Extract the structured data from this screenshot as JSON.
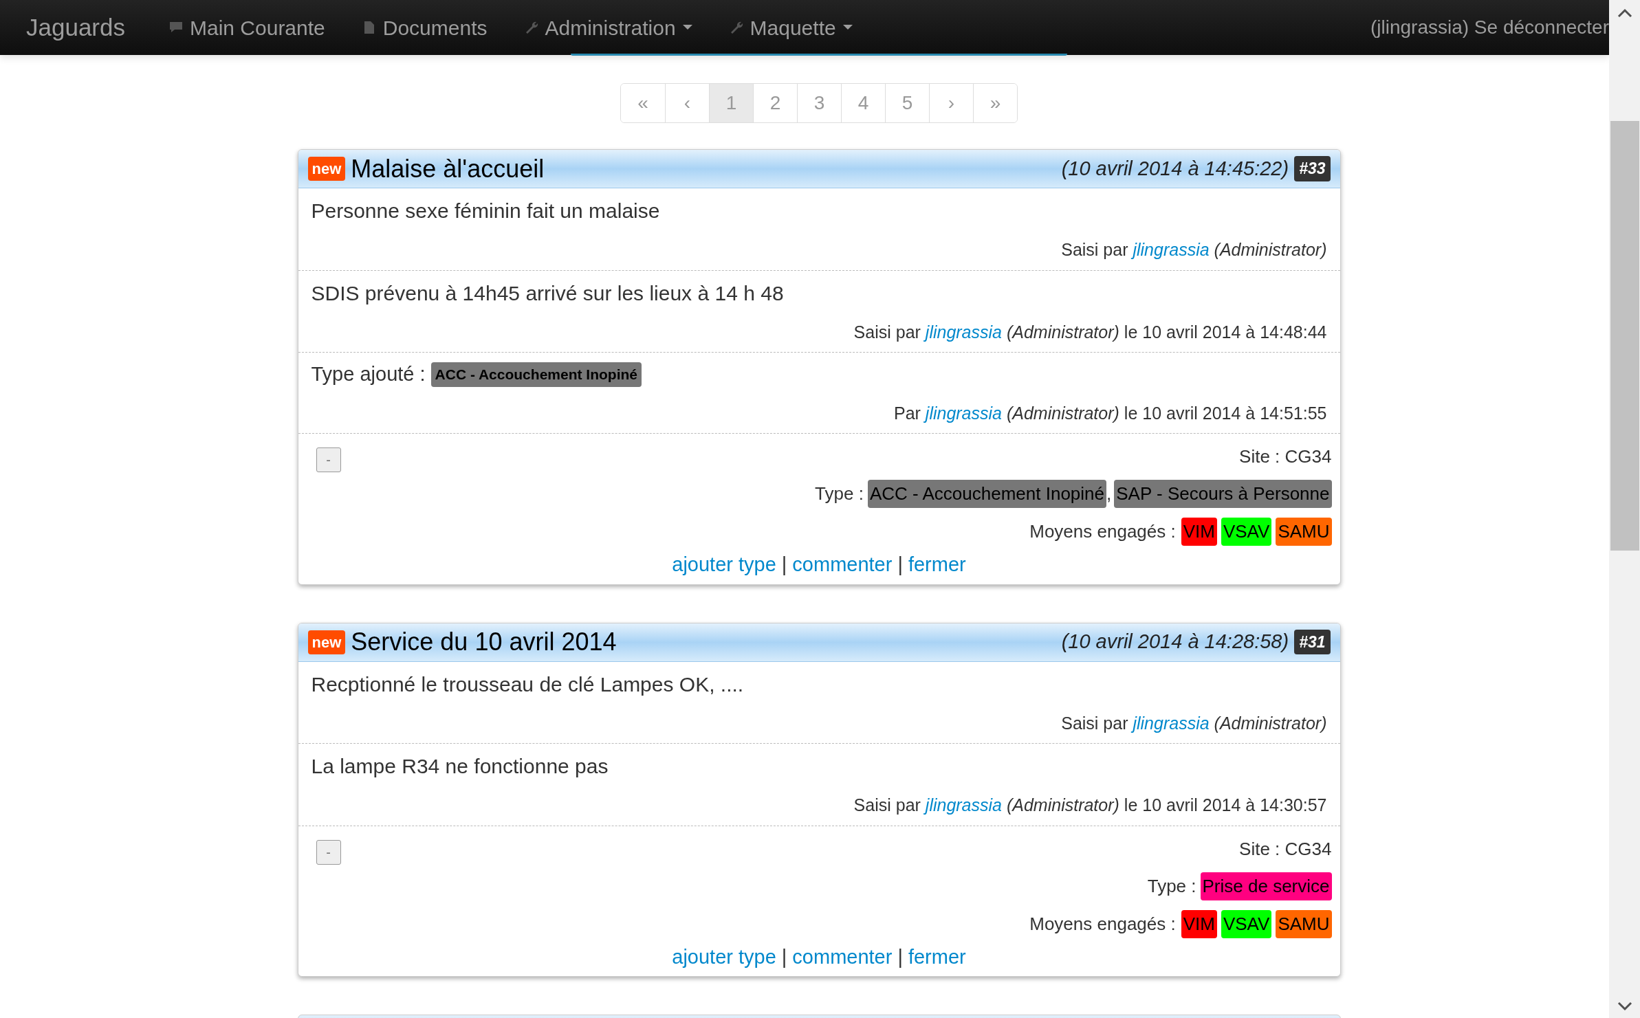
{
  "navbar": {
    "brand": "Jaguards",
    "items": [
      {
        "label": "Main Courante",
        "dropdown": false
      },
      {
        "label": "Documents",
        "dropdown": false
      },
      {
        "label": "Administration",
        "dropdown": true
      },
      {
        "label": "Maquette",
        "dropdown": true
      }
    ],
    "user_link": "(jlingrassia) Se déconnecter"
  },
  "pagination": [
    {
      "label": "«",
      "selected": false
    },
    {
      "label": "‹",
      "selected": false
    },
    {
      "label": "1",
      "selected": true
    },
    {
      "label": "2",
      "selected": false
    },
    {
      "label": "3",
      "selected": false
    },
    {
      "label": "4",
      "selected": false
    },
    {
      "label": "5",
      "selected": false
    },
    {
      "label": "›",
      "selected": false
    },
    {
      "label": "»",
      "selected": false
    }
  ],
  "events": [
    {
      "badge": "new",
      "title": "Malaise àl'accueil",
      "timestamp": "(10 avril 2014 à 14:45:22)",
      "number": "#33",
      "entries": [
        {
          "kind": "comment",
          "text": "Personne sexe féminin fait un malaise",
          "prefix": "Saisi par",
          "author": "jlingrassia",
          "role": "(Administrator)"
        },
        {
          "kind": "comment",
          "text": "SDIS prévenu à 14h45 arrivé sur les lieux à 14 h 48",
          "prefix": "Saisi par",
          "author": "jlingrassia",
          "role": "(Administrator)",
          "suffix": "le 10 avril 2014 à 14:48:44"
        },
        {
          "kind": "type_added",
          "text": "Type ajouté :",
          "tag": {
            "label": "ACC - Accouchement Inopiné",
            "color": "#777777"
          },
          "prefix": "Par",
          "author": "jlingrassia",
          "role": "(Administrator)",
          "suffix": "le 10 avril 2014 à 14:51:55"
        }
      ],
      "toggle": "-",
      "site": "Site : CG34",
      "type_label": "Type :",
      "type_separator": ",",
      "types": [
        {
          "label": "ACC - Accouchement Inopiné",
          "color": "#777777"
        },
        {
          "label": "SAP - Secours à Personne",
          "color": "#777777"
        }
      ],
      "means_label": "Moyens engagés :",
      "means": [
        {
          "label": "VIM",
          "color": "#ff0000"
        },
        {
          "label": "VSAV",
          "color": "#00ff00"
        },
        {
          "label": "SAMU",
          "color": "#ff6600"
        }
      ],
      "actions": [
        "ajouter type",
        "commenter",
        "fermer"
      ],
      "action_separator": "|"
    },
    {
      "badge": "new",
      "title": "Service du 10 avril 2014",
      "timestamp": "(10 avril 2014 à 14:28:58)",
      "number": "#31",
      "entries": [
        {
          "kind": "comment",
          "text": "Recptionné le trousseau de clé Lampes OK, ....",
          "prefix": "Saisi par",
          "author": "jlingrassia",
          "role": "(Administrator)"
        },
        {
          "kind": "comment",
          "text": "La lampe R34 ne fonctionne pas",
          "prefix": "Saisi par",
          "author": "jlingrassia",
          "role": "(Administrator)",
          "suffix": "le 10 avril 2014 à 14:30:57"
        }
      ],
      "toggle": "-",
      "site": "Site : CG34",
      "type_label": "Type :",
      "types": [
        {
          "label": "Prise de service",
          "color": "#ff0080"
        }
      ],
      "means_label": "Moyens engagés :",
      "means": [
        {
          "label": "VIM",
          "color": "#ff0000"
        },
        {
          "label": "VSAV",
          "color": "#00ff00"
        },
        {
          "label": "SAMU",
          "color": "#ff6600"
        }
      ],
      "actions": [
        "ajouter type",
        "commenter",
        "fermer"
      ],
      "action_separator": "|"
    }
  ]
}
